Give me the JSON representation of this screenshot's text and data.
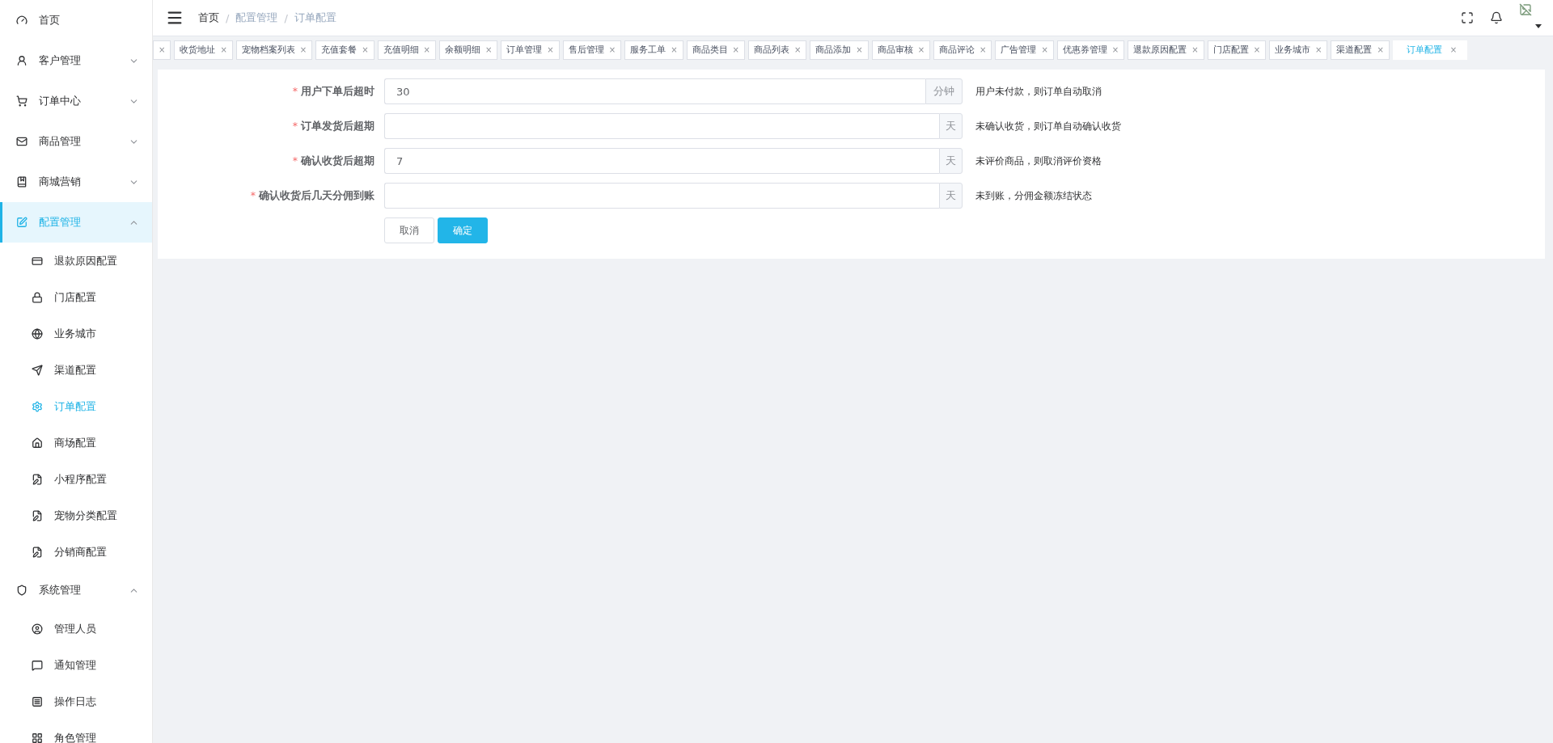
{
  "sidebar": {
    "items": [
      {
        "label": "首页",
        "selected": false
      },
      {
        "label": "客户管理",
        "selected": false,
        "expanded": false
      },
      {
        "label": "订单中心",
        "selected": false,
        "expanded": false
      },
      {
        "label": "商品管理",
        "selected": false,
        "expanded": false
      },
      {
        "label": "商城营销",
        "selected": false,
        "expanded": false
      },
      {
        "label": "配置管理",
        "selected": true,
        "expanded": true,
        "children": [
          {
            "label": "退款原因配置",
            "selected": false
          },
          {
            "label": "门店配置",
            "selected": false
          },
          {
            "label": "业务城市",
            "selected": false
          },
          {
            "label": "渠道配置",
            "selected": false
          },
          {
            "label": "订单配置",
            "selected": true
          },
          {
            "label": "商场配置",
            "selected": false
          },
          {
            "label": "小程序配置",
            "selected": false
          },
          {
            "label": "宠物分类配置",
            "selected": false
          },
          {
            "label": "分销商配置",
            "selected": false
          }
        ]
      },
      {
        "label": "系统管理",
        "selected": false,
        "expanded": true,
        "children": [
          {
            "label": "管理人员",
            "selected": false
          },
          {
            "label": "通知管理",
            "selected": false
          },
          {
            "label": "操作日志",
            "selected": false
          },
          {
            "label": "角色管理",
            "selected": false
          }
        ]
      }
    ]
  },
  "breadcrumb": [
    "首页",
    "配置管理",
    "订单配置"
  ],
  "breadcrumb_separator": "/",
  "tabs": [
    {
      "close": "×",
      "selected": false
    },
    {
      "label": "收货地址",
      "close": "×",
      "selected": false
    },
    {
      "label": "宠物档案列表",
      "close": "×",
      "selected": false
    },
    {
      "label": "充值套餐",
      "close": "×",
      "selected": false
    },
    {
      "label": "充值明细",
      "close": "×",
      "selected": false
    },
    {
      "label": "余额明细",
      "close": "×",
      "selected": false
    },
    {
      "label": "订单管理",
      "close": "×",
      "selected": false
    },
    {
      "label": "售后管理",
      "close": "×",
      "selected": false
    },
    {
      "label": "服务工单",
      "close": "×",
      "selected": false
    },
    {
      "label": "商品类目",
      "close": "×",
      "selected": false
    },
    {
      "label": "商品列表",
      "close": "×",
      "selected": false
    },
    {
      "label": "商品添加",
      "close": "×",
      "selected": false
    },
    {
      "label": "商品审核",
      "close": "×",
      "selected": false
    },
    {
      "label": "商品评论",
      "close": "×",
      "selected": false
    },
    {
      "label": "广告管理",
      "close": "×",
      "selected": false
    },
    {
      "label": "优惠券管理",
      "close": "×",
      "selected": false
    },
    {
      "label": "退款原因配置",
      "close": "×",
      "selected": false
    },
    {
      "label": "门店配置",
      "close": "×",
      "selected": false
    },
    {
      "label": "业务城市",
      "close": "×",
      "selected": false
    },
    {
      "label": "渠道配置",
      "close": "×",
      "selected": false
    },
    {
      "label": "订单配置",
      "close": "×",
      "selected": true
    }
  ],
  "form": {
    "fields": [
      {
        "mark": "*",
        "label": "用户下单后超时",
        "value": "30",
        "unit": "分钟",
        "hint": "用户未付款，则订单自动取消"
      },
      {
        "mark": "*",
        "label": "订单发货后超期",
        "unit": "天",
        "hint": "未确认收货，则订单自动确认收货"
      },
      {
        "mark": "*",
        "label": "确认收货后超期",
        "value": "7",
        "unit": "天",
        "hint": "未评价商品，则取消评价资格"
      },
      {
        "mark": "*",
        "label": "确认收货后几天分佣到账",
        "unit": "天",
        "hint": "未到账，分佣金额冻结状态"
      }
    ],
    "buttons": [
      {
        "label": "取消",
        "kind": "default"
      },
      {
        "label": "确定",
        "kind": "primary"
      }
    ]
  }
}
